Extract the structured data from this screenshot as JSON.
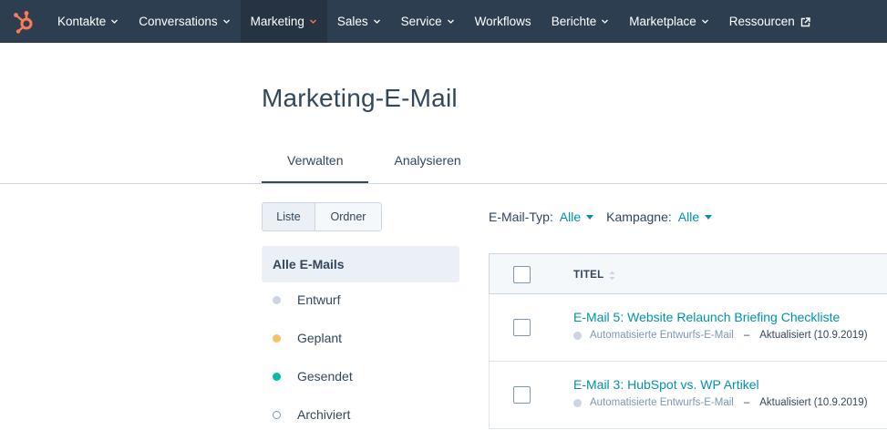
{
  "nav": {
    "logo_icon": "hubspot-sprocket-icon",
    "items": [
      {
        "label": "Kontakte",
        "caret": true
      },
      {
        "label": "Conversations",
        "caret": true
      },
      {
        "label": "Marketing",
        "caret": true,
        "active": true
      },
      {
        "label": "Sales",
        "caret": true
      },
      {
        "label": "Service",
        "caret": true
      },
      {
        "label": "Workflows",
        "caret": false
      },
      {
        "label": "Berichte",
        "caret": true
      },
      {
        "label": "Marketplace",
        "caret": true
      },
      {
        "label": "Ressourcen",
        "caret": false,
        "external": true
      }
    ]
  },
  "page": {
    "title": "Marketing-E-Mail"
  },
  "tabs": [
    {
      "label": "Verwalten",
      "active": true
    },
    {
      "label": "Analysieren",
      "active": false
    }
  ],
  "view_toggle": {
    "list": "Liste",
    "folder": "Ordner",
    "selected": "Liste"
  },
  "sidebar": {
    "selected": "Alle E-Mails",
    "items": [
      {
        "label": "Entwurf",
        "dot_color": "#cbd6e2"
      },
      {
        "label": "Geplant",
        "dot_color": "#f5c26b"
      },
      {
        "label": "Gesendet",
        "dot_color": "#00bda5"
      },
      {
        "label": "Archiviert",
        "dot_color": "hollow"
      }
    ]
  },
  "filters": {
    "type_label": "E-Mail-Typ:",
    "type_value": "Alle",
    "campaign_label": "Kampagne:",
    "campaign_value": "Alle"
  },
  "table": {
    "column_title": "TITEL",
    "rows": [
      {
        "title": "E-Mail 5: Website Relaunch Briefing Checkliste",
        "type": "Automatisierte Entwurfs-E-Mail",
        "separator": "–",
        "updated": "Aktualisiert (10.9.2019)"
      },
      {
        "title": "E-Mail 3: HubSpot vs. WP Artikel",
        "type": "Automatisierte Entwurfs-E-Mail",
        "separator": "–",
        "updated": "Aktualisiert (10.9.2019)"
      }
    ]
  },
  "colors": {
    "nav_bg": "#2d3e50",
    "accent_orange": "#ff7a59",
    "link": "#0091ae",
    "text": "#33475b"
  }
}
